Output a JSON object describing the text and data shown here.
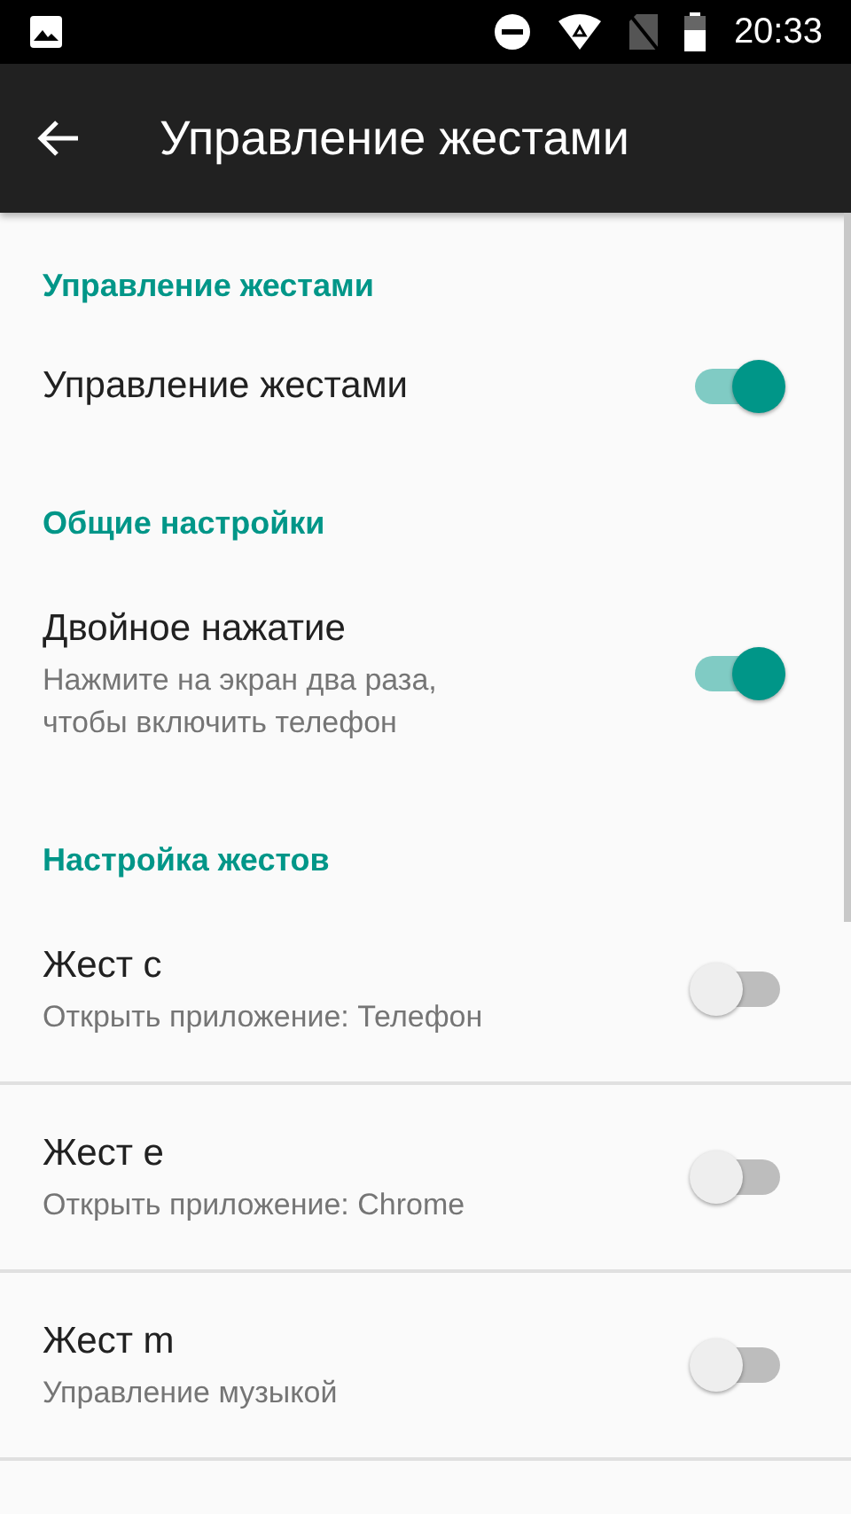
{
  "status_bar": {
    "time": "20:33"
  },
  "app_bar": {
    "title": "Управление жестами"
  },
  "sections": [
    {
      "header": "Управление жестами",
      "divided": false,
      "items": [
        {
          "title": "Управление жестами",
          "on": true
        }
      ]
    },
    {
      "header": "Общие настройки",
      "divided": false,
      "items": [
        {
          "title": "Двойное нажатие",
          "subtitle": "Нажмите на экран два раза,\nчтобы включить телефон",
          "on": true
        }
      ]
    },
    {
      "header": "Настройка жестов",
      "divided": true,
      "items": [
        {
          "title": "Жест c",
          "subtitle": "Открыть приложение: Телефон",
          "on": false
        },
        {
          "title": "Жест e",
          "subtitle": "Открыть приложение: Chrome",
          "on": false
        },
        {
          "title": "Жест m",
          "subtitle": "Управление музыкой",
          "on": false
        }
      ]
    }
  ]
}
